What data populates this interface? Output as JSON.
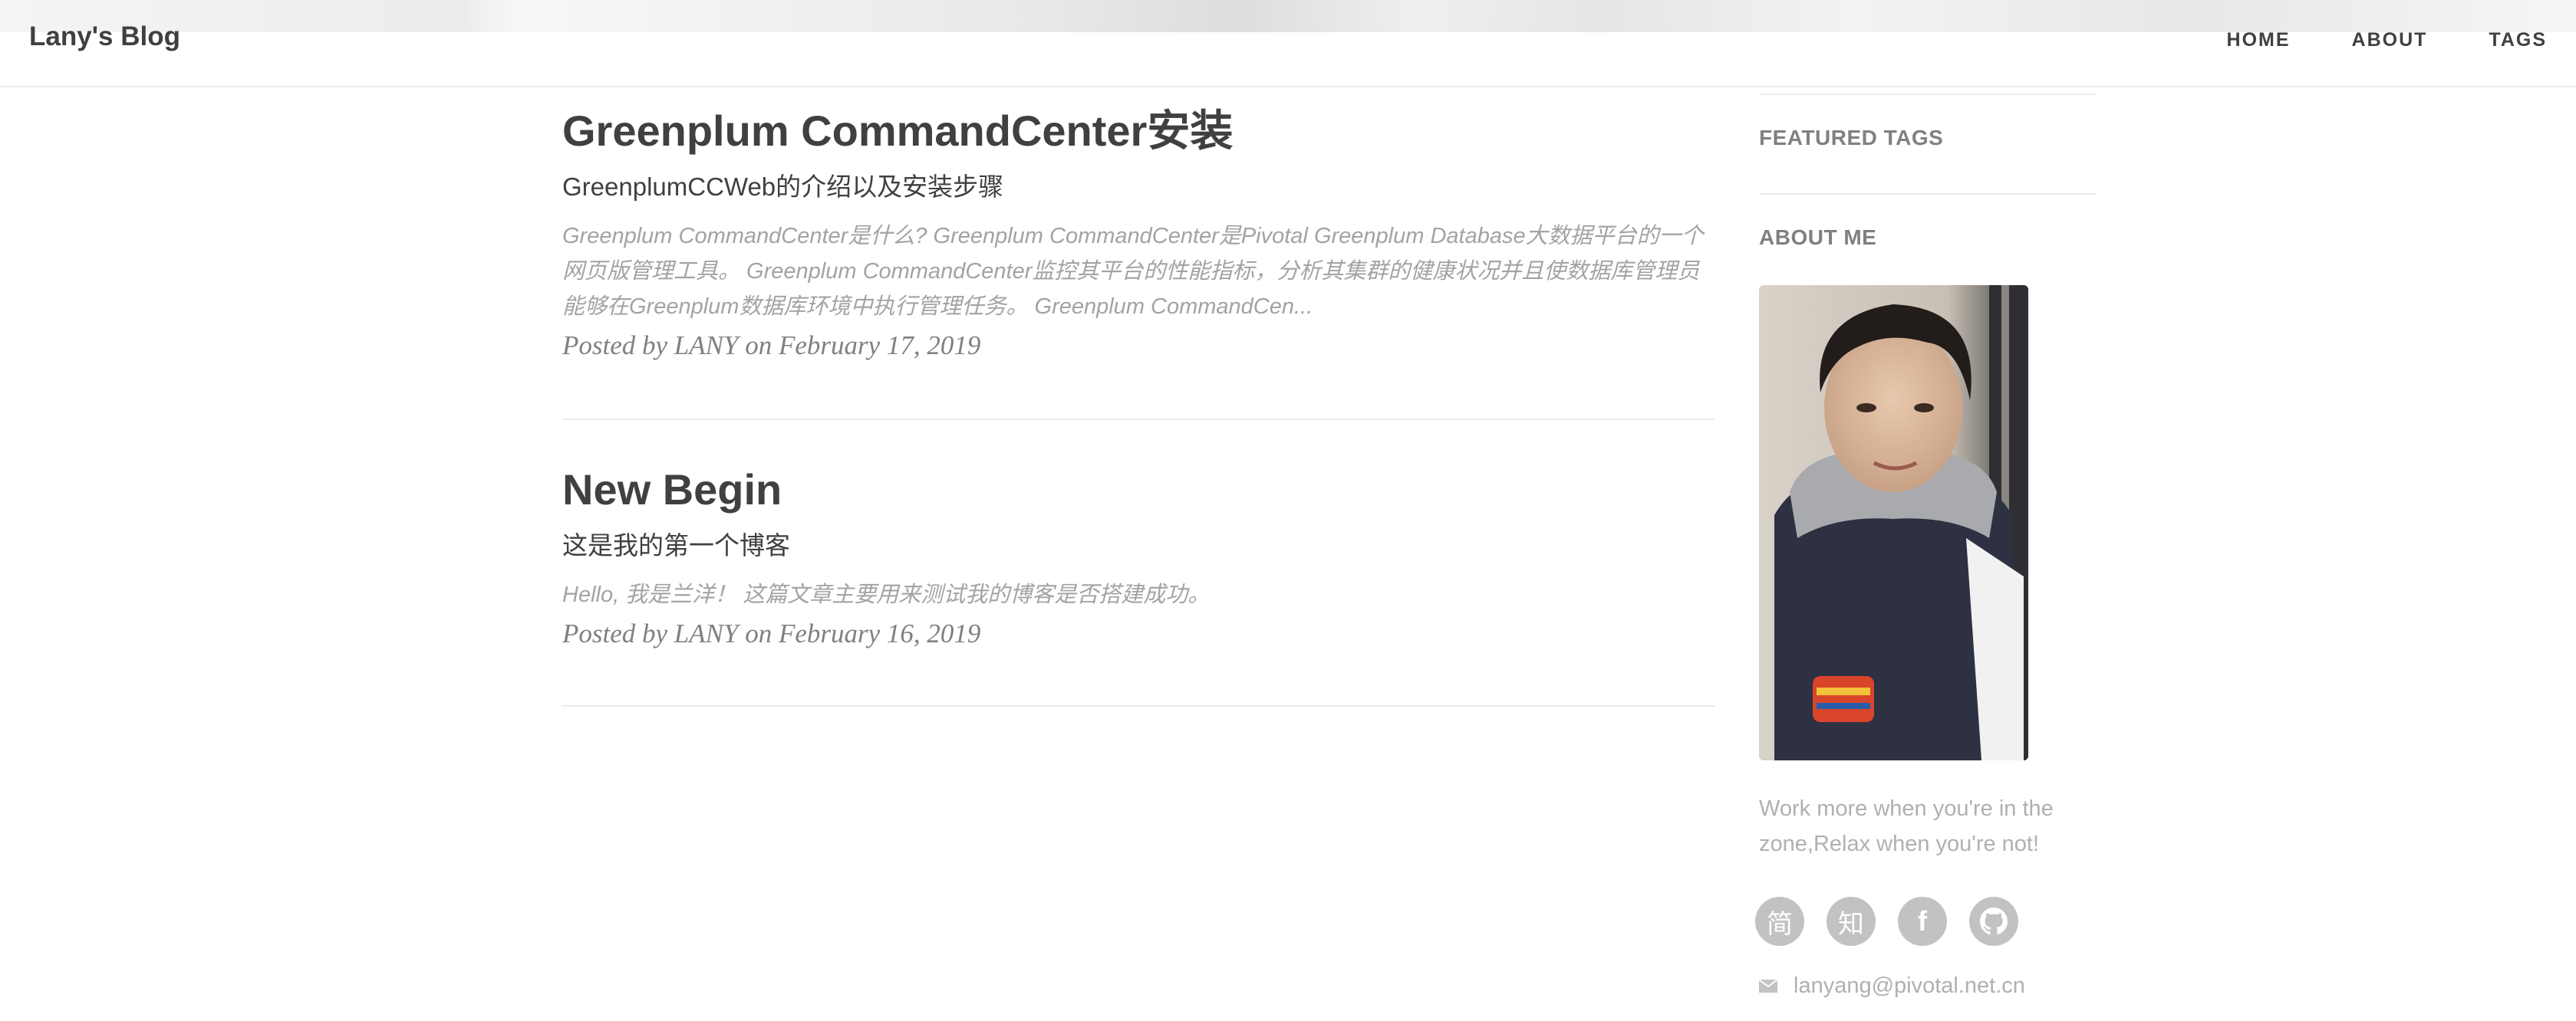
{
  "navbar": {
    "brand": "Lany's Blog",
    "links": [
      "HOME",
      "ABOUT",
      "TAGS"
    ]
  },
  "posts": [
    {
      "title": "Greenplum CommandCenter安装",
      "subtitle": "GreenplumCCWeb的介绍以及安装步骤",
      "excerpt": "Greenplum CommandCenter是什么? Greenplum CommandCenter是Pivotal Greenplum Database大数据平台的一个网页版管理工具。 Greenplum CommandCenter监控其平台的性能指标，分析其集群的健康状况并且使数据库管理员能够在Greenplum数据库环境中执行管理任务。 Greenplum CommandCen...",
      "meta": "Posted by LANY on February 17, 2019"
    },
    {
      "title": "New Begin",
      "subtitle": "这是我的第一个博客",
      "excerpt": "Hello, 我是兰洋！ 这篇文章主要用来测试我的博客是否搭建成功。",
      "meta": "Posted by LANY on February 16, 2019"
    }
  ],
  "sidebar": {
    "featured_tags_heading": "FEATURED TAGS",
    "about_heading": "ABOUT ME",
    "bio": "Work more when you're in the zone,Relax when you're not!",
    "social": [
      "简",
      "知",
      "f",
      "github"
    ],
    "email": "lanyang@pivotal.net.cn"
  }
}
